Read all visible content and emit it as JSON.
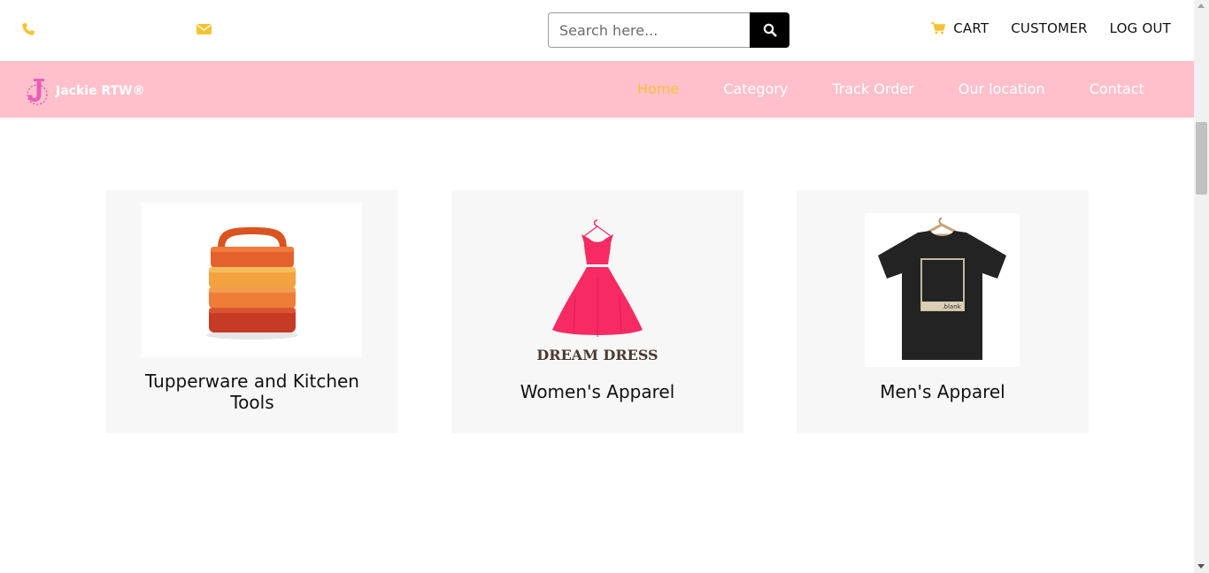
{
  "topbar": {
    "icons": {
      "phone": "phone-icon",
      "mail": "mail-icon",
      "search": "search-icon",
      "cart": "cart-icon"
    },
    "search": {
      "placeholder": "Search here..."
    },
    "links": {
      "cart": "CART",
      "customer": "CUSTOMER",
      "logout": "LOG OUT"
    }
  },
  "navbar": {
    "brand": "Jackie RTW®",
    "items": [
      {
        "label": "Home",
        "active": true
      },
      {
        "label": "Category",
        "active": false
      },
      {
        "label": "Track Order",
        "active": false
      },
      {
        "label": "Our location",
        "active": false
      },
      {
        "label": "Contact",
        "active": false
      }
    ]
  },
  "categories": [
    {
      "title": "Tupperware and Kitchen Tools",
      "image": "stacked-food-containers"
    },
    {
      "title": "Women's Apparel",
      "image": "red-dress",
      "image_text": "DREAM DRESS"
    },
    {
      "title": "Men's Apparel",
      "image": "black-tshirt-on-hanger",
      "image_text": ".blank"
    }
  ],
  "colors": {
    "accent": "#f7c232",
    "nav_bg": "#ffc0cb",
    "card_bg": "#f7f7f7",
    "dress": "#f72a63"
  }
}
